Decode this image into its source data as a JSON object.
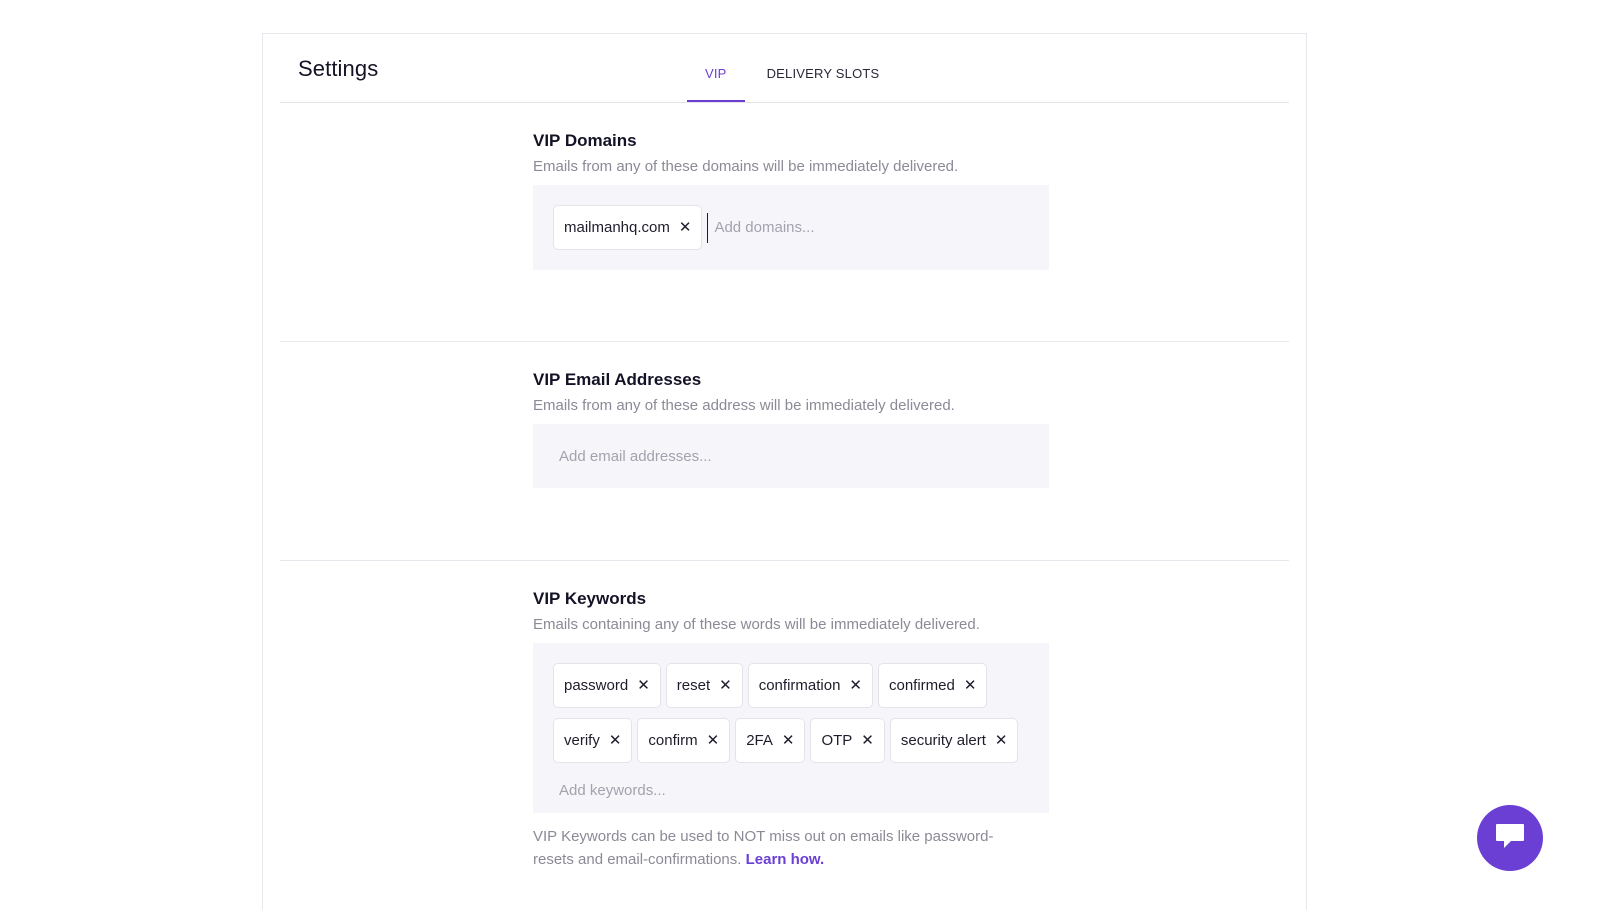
{
  "page": {
    "title": "Settings"
  },
  "tabs": [
    {
      "label": "VIP",
      "active": true
    },
    {
      "label": "DELIVERY SLOTS",
      "active": false
    }
  ],
  "vip_domains": {
    "title": "VIP Domains",
    "description": "Emails from any of these domains will be immediately delivered.",
    "chips": [
      "mailmanhq.com"
    ],
    "placeholder": "Add domains..."
  },
  "vip_emails": {
    "title": "VIP Email Addresses",
    "description": "Emails from any of these address will be immediately delivered.",
    "chips": [],
    "placeholder": "Add email addresses..."
  },
  "vip_keywords": {
    "title": "VIP Keywords",
    "description": "Emails containing any of these words will be immediately delivered.",
    "chips": [
      "password",
      "reset",
      "confirmation",
      "confirmed",
      "verify",
      "confirm",
      "2FA",
      "OTP",
      "security alert"
    ],
    "placeholder": "Add keywords...",
    "note": "VIP Keywords can be used to NOT miss out on emails like password-resets and email-confirmations.",
    "link_label": "Learn how."
  },
  "icons": {
    "chip_remove": "close-icon",
    "chat": "chat-bubble-icon"
  },
  "colors": {
    "accent": "#6b3fd4"
  }
}
